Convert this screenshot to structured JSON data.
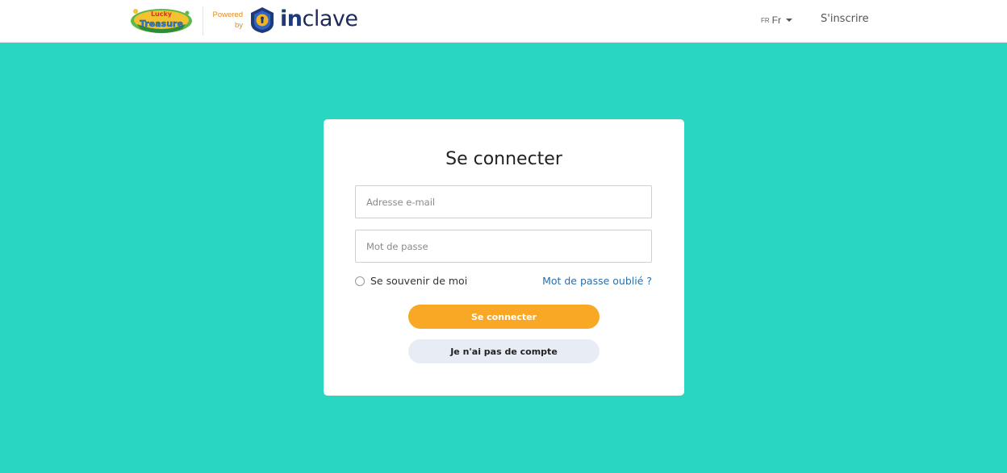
{
  "header": {
    "brand_logo_text": "Lucky Treasure",
    "powered_by_line1": "Powered",
    "powered_by_line2": "by",
    "partner_name_bold": "in",
    "partner_name_rest": "clave",
    "lang_code": "FR",
    "lang_label": "Fr",
    "signup_label": "S'inscrire"
  },
  "login": {
    "title": "Se connecter",
    "email_placeholder": "Adresse e-mail",
    "email_value": "",
    "password_placeholder": "Mot de passe",
    "password_value": "",
    "remember_label": "Se souvenir de moi",
    "remember_checked": false,
    "forgot_label": "Mot de passe oublié ?",
    "submit_label": "Se connecter",
    "no_account_label": "Je n'ai pas de compte"
  },
  "colors": {
    "background": "#29d6c2",
    "primary_button": "#f9a825",
    "secondary_button": "#e8ecf4",
    "link": "#2a6fab",
    "powered_by": "#e38b1b",
    "partner_navy": "#1d2b59"
  },
  "icons": {
    "brand": "lucky-treasure-logo",
    "partner": "shield-lock-icon",
    "lang_caret": "caret-down-icon",
    "remember": "radio-icon"
  }
}
